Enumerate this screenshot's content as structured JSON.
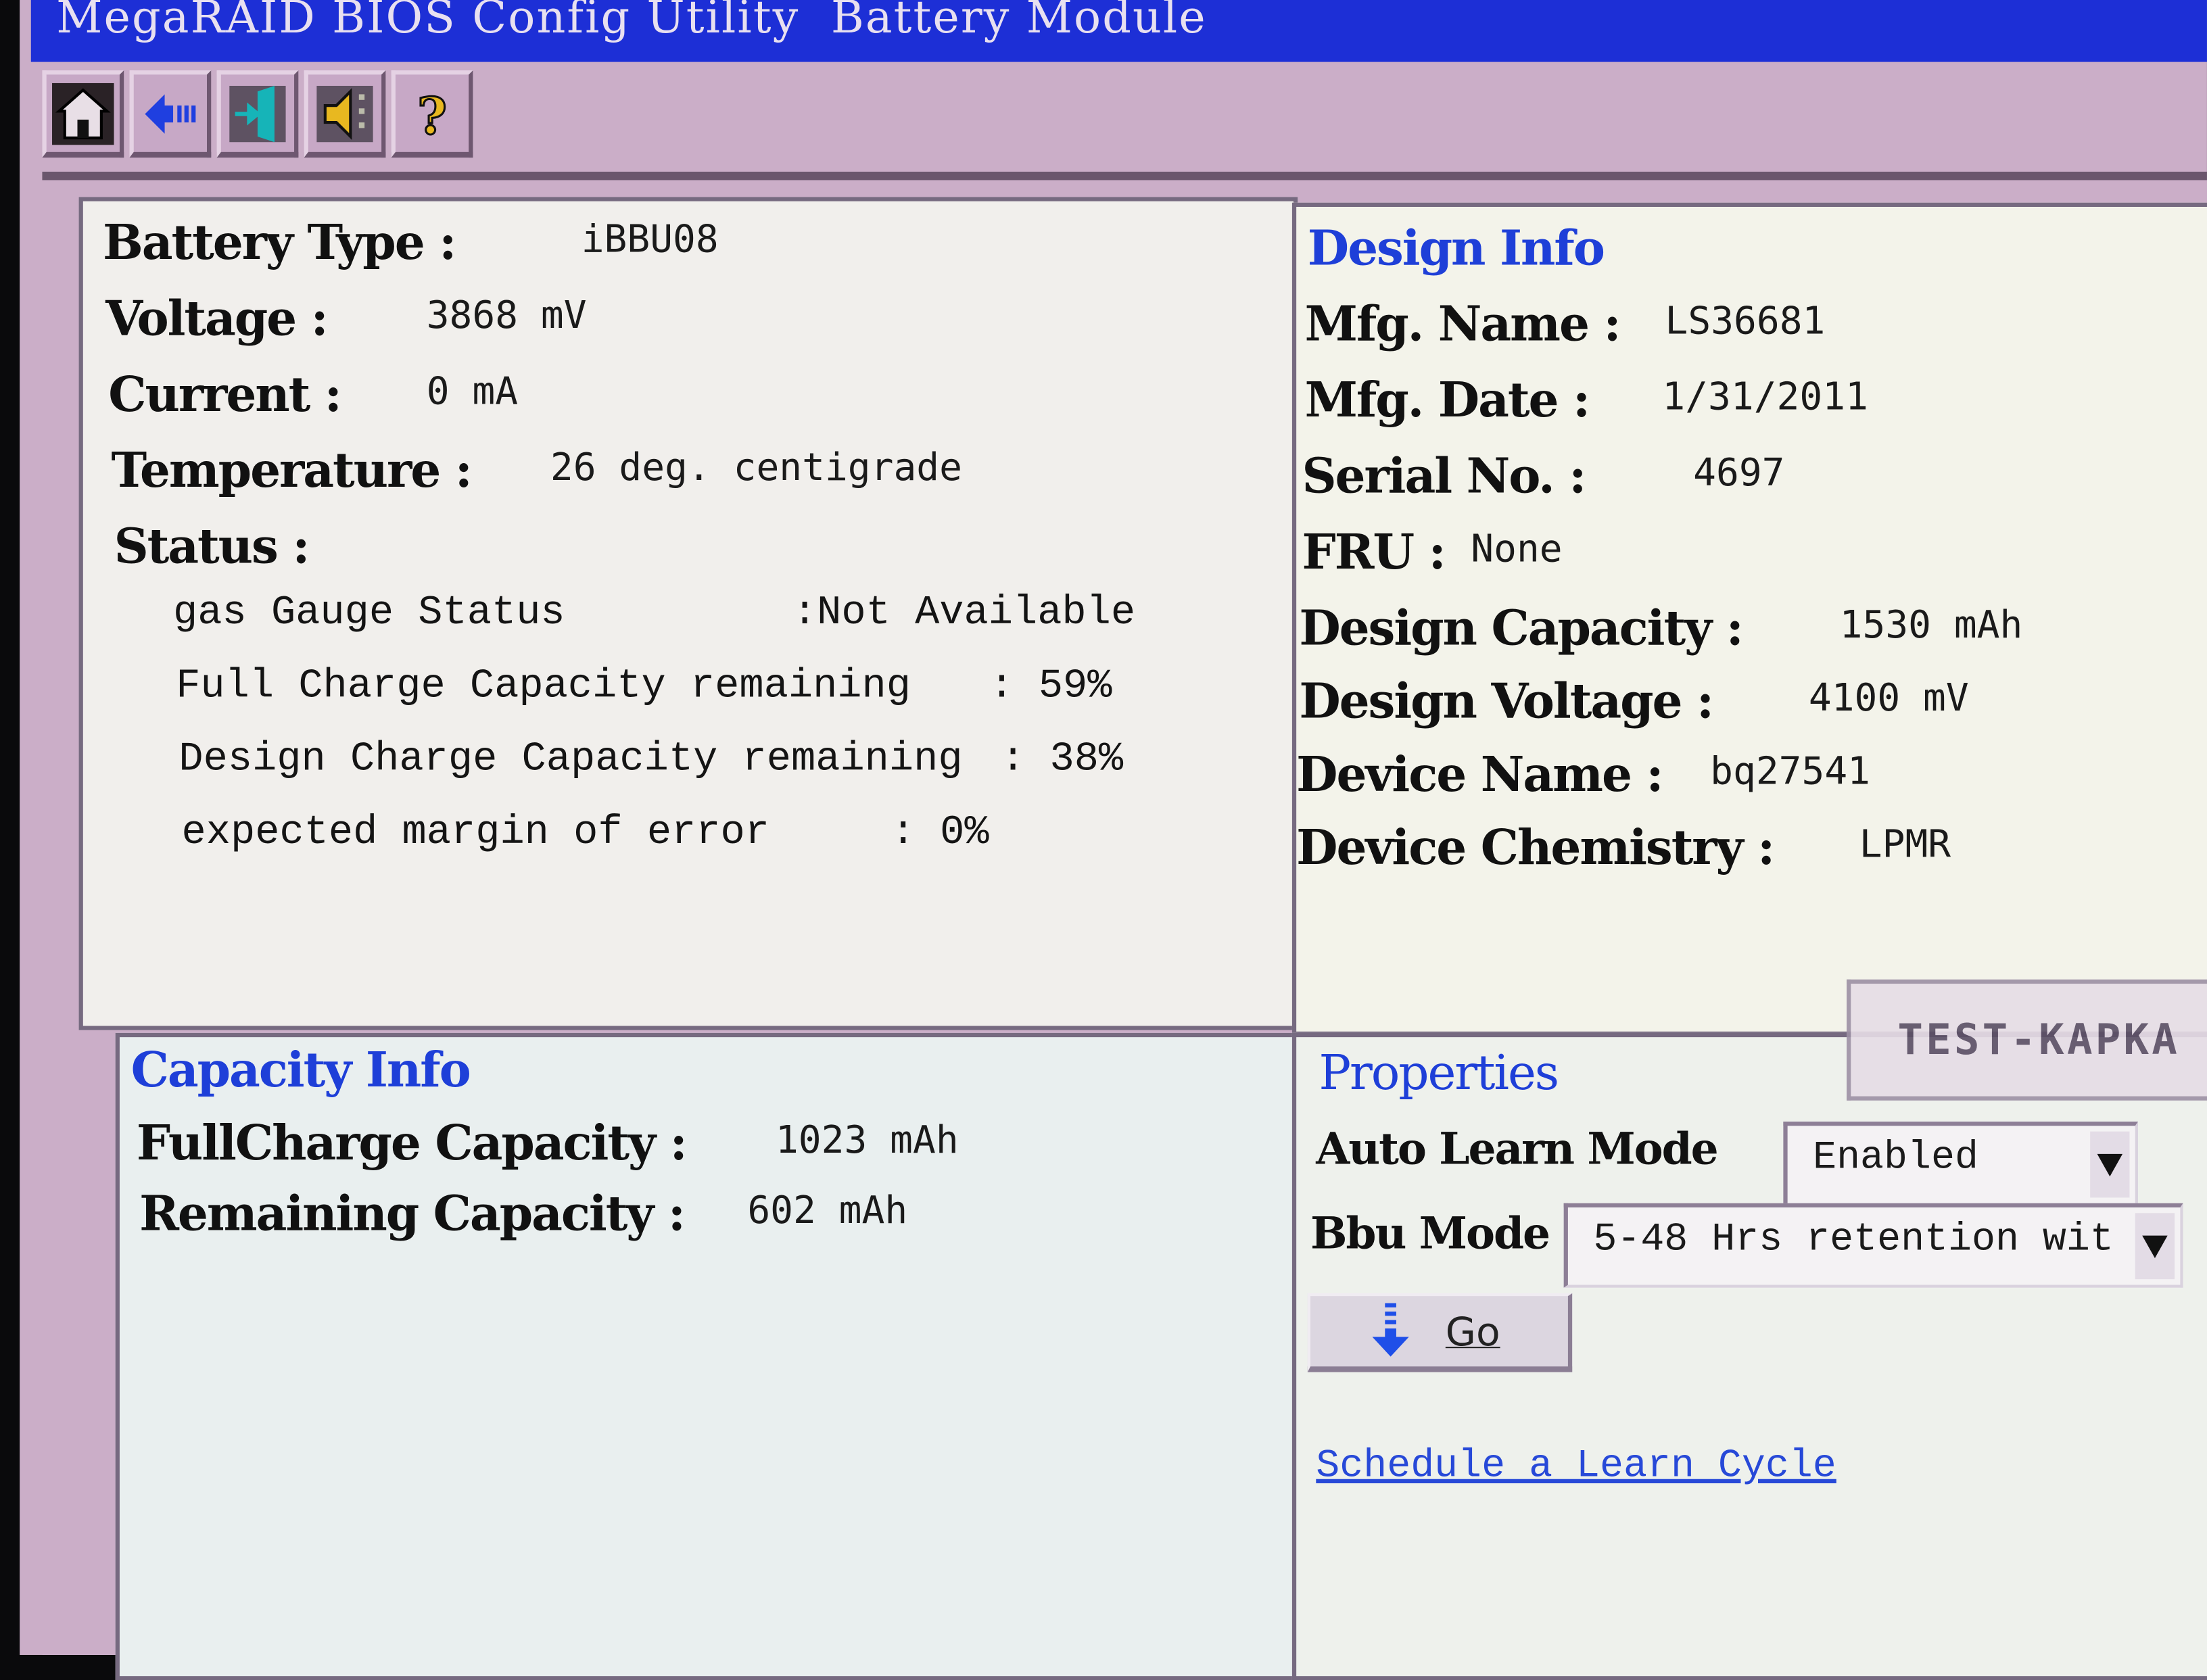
{
  "window": {
    "title": "MegaRAID BIOS Config Utility  Battery Module"
  },
  "toolbar": {
    "buttons": [
      {
        "icon": "home-icon",
        "tooltip": "Home"
      },
      {
        "icon": "back-arrow-icon",
        "tooltip": "Back"
      },
      {
        "icon": "exit-door-icon",
        "tooltip": "Exit"
      },
      {
        "icon": "speaker-icon",
        "tooltip": "Alarm"
      },
      {
        "icon": "help-question-icon",
        "tooltip": "Help"
      }
    ]
  },
  "battery": {
    "type_label": "Battery Type :",
    "type_value": "iBBU08",
    "voltage_label": "Voltage :",
    "voltage_value": "3868 mV",
    "current_label": "Current :",
    "current_value": "0 mA",
    "temperature_label": "Temperature :",
    "temperature_value": "26 deg. centigrade",
    "status_label": "Status :",
    "status_items": [
      {
        "label": "gas Gauge Status",
        "value": ":Not Available"
      },
      {
        "label": "Full Charge Capacity remaining",
        "value": ": 59%"
      },
      {
        "label": "Design Charge Capacity remaining",
        "value": ": 38%"
      },
      {
        "label": "expected margin of error",
        "value": ": 0%"
      }
    ]
  },
  "design_info": {
    "heading": "Design Info",
    "fields": [
      {
        "label": "Mfg. Name :",
        "value": "LS36681"
      },
      {
        "label": "Mfg. Date :",
        "value": "1/31/2011"
      },
      {
        "label": "Serial No. :",
        "value": "4697"
      },
      {
        "label": "FRU :",
        "value": "None"
      },
      {
        "label": "Design Capacity :",
        "value": "1530 mAh"
      },
      {
        "label": "Design Voltage :",
        "value": "4100 mV"
      },
      {
        "label": "Device Name :",
        "value": "bq27541"
      },
      {
        "label": "Device Chemistry :",
        "value": "LPMR"
      }
    ]
  },
  "capacity_info": {
    "heading": "Capacity Info",
    "fields": [
      {
        "label": "FullCharge Capacity :",
        "value": "1023 mAh"
      },
      {
        "label": "Remaining Capacity :",
        "value": "602 mAh"
      }
    ]
  },
  "properties": {
    "heading": "Properties",
    "auto_learn_mode_label": "Auto Learn Mode",
    "auto_learn_mode_value": "Enabled",
    "bbu_mode_label": "Bbu Mode",
    "bbu_mode_value": "5-48 Hrs retention wit",
    "go_label": "Go",
    "schedule_link": "Schedule a Learn Cycle"
  },
  "overlay": {
    "watermark": "TEST-KAPKA"
  },
  "colors": {
    "title_bar": "#1d2fd6",
    "frame": "#cbaec8",
    "heading": "#1e3fd8",
    "link": "#2749d8"
  }
}
